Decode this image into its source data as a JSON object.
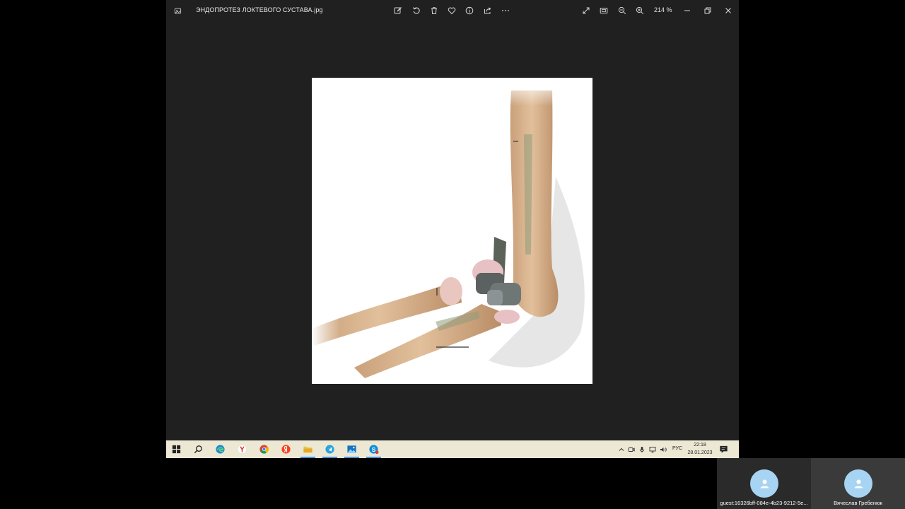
{
  "viewer": {
    "file_name": "ЭНДОПРОТЕЗ ЛОКТЕВОГО СУСТАВА.jpg",
    "zoom": "214 %",
    "toolbar_icons": [
      "edit-icon",
      "rotate-icon",
      "delete-icon",
      "favorite-icon",
      "info-icon",
      "share-icon",
      "more-icon"
    ],
    "view_icons": [
      "fullscreen-icon",
      "fit-icon",
      "zoom-out-icon",
      "zoom-in-icon"
    ],
    "window_icons": [
      "minimize-icon",
      "restore-icon",
      "close-icon"
    ],
    "image_subject": "elbow-joint-endoprosthesis-illustration"
  },
  "taskbar": {
    "apps": [
      "windows-start-icon",
      "search-icon",
      "edge-icon",
      "yandex-browser-icon",
      "chrome-icon",
      "yandex-icon",
      "file-explorer-icon",
      "telegram-icon",
      "photos-icon",
      "skype-icon"
    ],
    "tray_icons": [
      "chevron-up-icon",
      "meet-now-icon",
      "microphone-icon",
      "network-icon",
      "volume-icon"
    ],
    "language": "РУС",
    "time": "22:18",
    "date": "28.01.2023",
    "accent": "#4a90d9"
  },
  "participants": [
    {
      "name": "guest:16326bff-084e-4b23-9212-5e..."
    },
    {
      "name": "Вячеслав Гребенюк"
    }
  ],
  "colors": {
    "desktop": "#000000",
    "viewer_bg": "#202020",
    "taskbar_bg": "#ece8d4",
    "avatar": "#a6d4f2"
  }
}
